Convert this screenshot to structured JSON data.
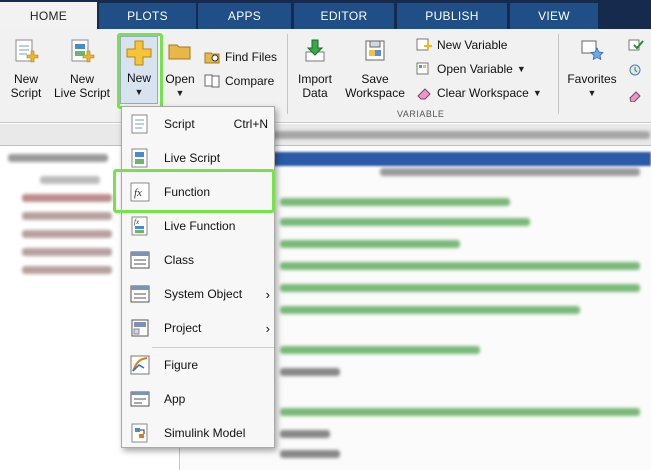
{
  "tabs": [
    {
      "label": "HOME",
      "active": true
    },
    {
      "label": "PLOTS",
      "active": false
    },
    {
      "label": "APPS",
      "active": false
    },
    {
      "label": "EDITOR",
      "active": false
    },
    {
      "label": "PUBLISH",
      "active": false
    },
    {
      "label": "VIEW",
      "active": false
    }
  ],
  "ribbon": {
    "new_script": [
      "New",
      "Script"
    ],
    "new_live_script": [
      "New",
      "Live Script"
    ],
    "new": "New",
    "open": "Open",
    "find_files": "Find Files",
    "compare": "Compare",
    "import_data": [
      "Import",
      "Data"
    ],
    "save_workspace": [
      "Save",
      "Workspace"
    ],
    "new_variable": "New Variable",
    "open_variable": "Open Variable",
    "clear_workspace": "Clear Workspace",
    "variable_group": "VARIABLE",
    "favorites": "Favorites"
  },
  "menu": {
    "items": [
      {
        "label": "Script",
        "shortcut": "Ctrl+N",
        "submenu": false
      },
      {
        "label": "Live Script",
        "shortcut": "",
        "submenu": false
      },
      {
        "label": "Function",
        "shortcut": "",
        "submenu": false,
        "highlighted": true
      },
      {
        "label": "Live Function",
        "shortcut": "",
        "submenu": false
      },
      {
        "label": "Class",
        "shortcut": "",
        "submenu": false
      },
      {
        "label": "System Object",
        "shortcut": "",
        "submenu": true
      },
      {
        "label": "Project",
        "shortcut": "",
        "submenu": true
      },
      {
        "label": "Figure",
        "shortcut": "",
        "submenu": false
      },
      {
        "label": "App",
        "shortcut": "",
        "submenu": false
      },
      {
        "label": "Simulink Model",
        "shortcut": "",
        "submenu": false
      }
    ]
  },
  "colors": {
    "tab_bar": "#152a4d",
    "tab": "#1f4f86",
    "highlight": "#76e34c",
    "ribbon": "#f1f1f1"
  }
}
